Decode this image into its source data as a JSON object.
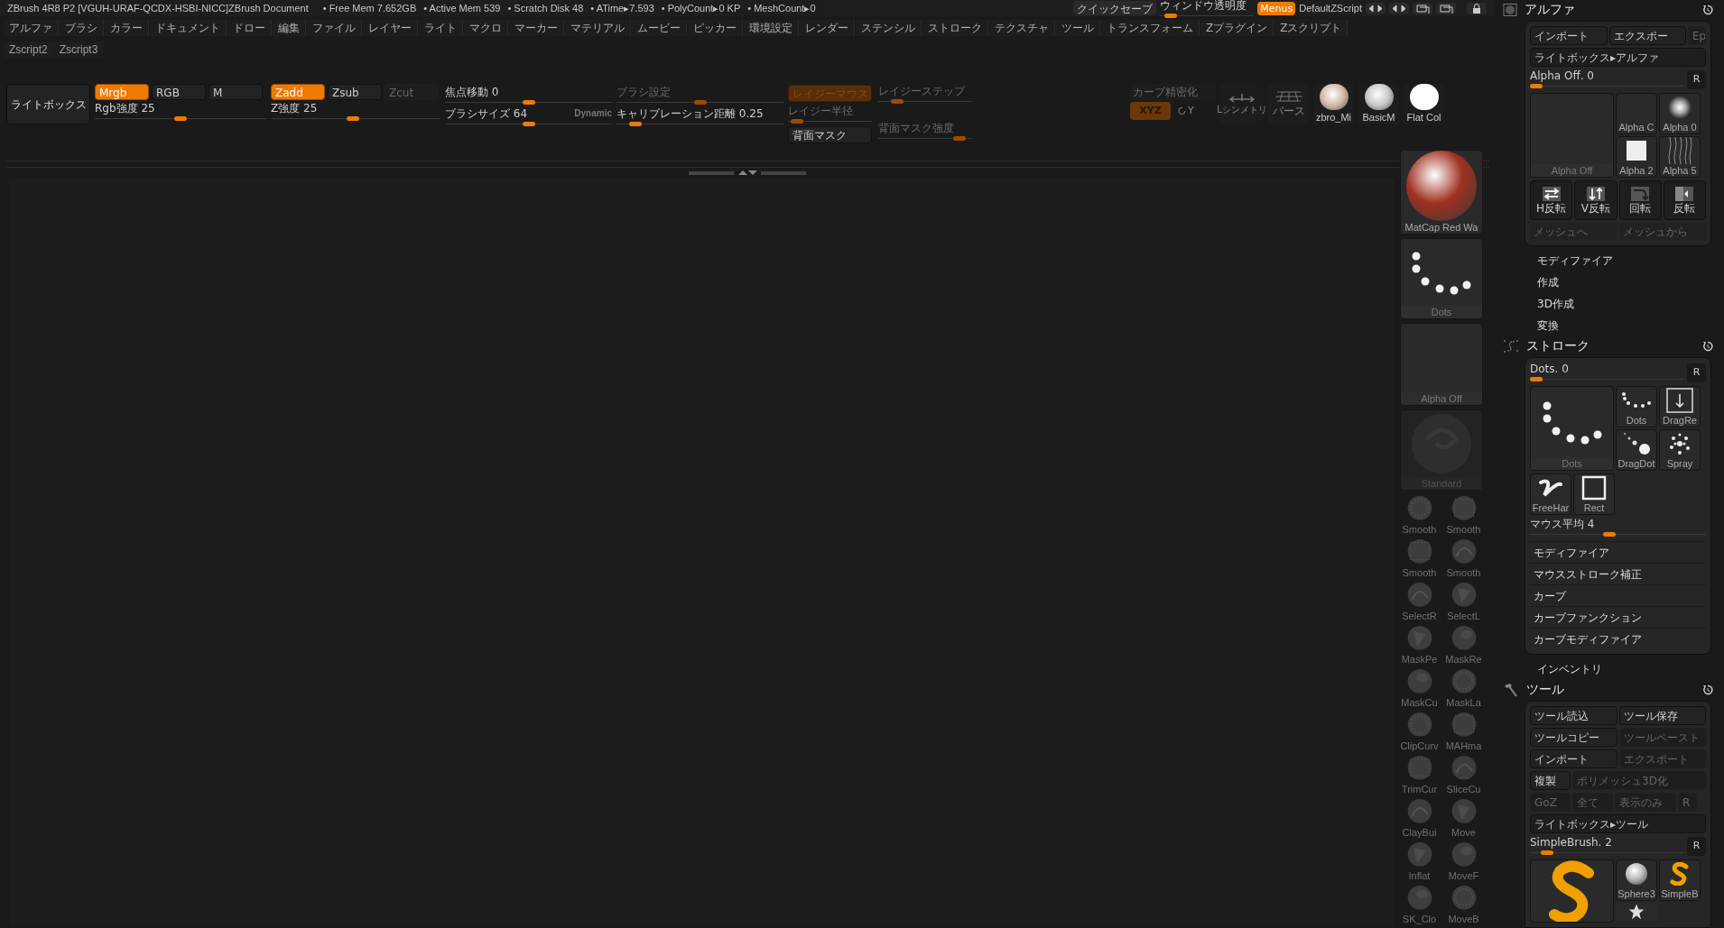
{
  "title_bar": {
    "title": "ZBrush 4R8 P2 [VGUH-URAF-QCDX-HSBI-NICC]ZBrush Document",
    "stats": [
      "• Free Mem 7.652GB",
      "• Active Mem 539",
      "• Scratch Disk 48",
      "• ATime▸7.593",
      "• PolyCount▸0 KP",
      "• MeshCount▸0"
    ],
    "quick_save": "クイックセーブ",
    "window_opacity": {
      "label": "ウィンドウ透明度",
      "level": 0.05
    },
    "menus_button": {
      "label": "Menus",
      "selected": true
    },
    "script_name": "DefaultZScript"
  },
  "menu_bar": [
    "アルファ",
    "ブラシ",
    "カラー",
    "ドキュメント",
    "ドロー",
    "編集",
    "ファイル",
    "レイヤー",
    "ライト",
    "マクロ",
    "マーカー",
    "マテリアル",
    "ムービー",
    "ピッカー",
    "環境設定",
    "レンダー",
    "ステンシル",
    "ストローク",
    "テクスチャ",
    "ツール",
    "トランスフォーム",
    "Zプラグイン",
    "Zスクリプト"
  ],
  "script_tabs": [
    "Zscript2",
    "Zscript3"
  ],
  "toolbar": {
    "lightbox": "ライトボックス",
    "rgb_modes": [
      {
        "label": "Mrgb",
        "selected": true
      },
      {
        "label": "RGB",
        "selected": false
      },
      {
        "label": "M",
        "selected": false
      }
    ],
    "rgb_intensity": {
      "label": "Rgb強度 25",
      "level": 0.5
    },
    "z_modes": [
      {
        "label": "Zadd",
        "selected": true,
        "disabled": false
      },
      {
        "label": "Zsub",
        "selected": false,
        "disabled": false
      },
      {
        "label": "Zcut",
        "selected": false,
        "disabled": true
      }
    ],
    "z_intensity": {
      "label": "Z強度 25",
      "level": 0.48
    },
    "focal_shift": {
      "label": "焦点移動 0",
      "level": 0.5
    },
    "draw_size": {
      "label": "ブラシサイズ 64",
      "level": 0.5
    },
    "dynamic": "Dynamic",
    "brush_settings": {
      "label": "ブラシ設定",
      "level": 0.5,
      "disabled": true
    },
    "calibration": {
      "label": "キャリブレーション距離 0.25",
      "level": 0.08,
      "disabled": false
    },
    "lazy_mouse": {
      "label": "レイジーマウス",
      "selected": true,
      "disabled": true
    },
    "lazy_step": {
      "label": "レイジーステップ",
      "level": 0.15,
      "disabled": true
    },
    "lazy_radius": {
      "label": "レイジー半径",
      "level": 0.04,
      "disabled": true
    },
    "backface_mask": {
      "label": "背面マスク",
      "selected": false
    },
    "backface_intensity": {
      "label": "背面マスク強度",
      "level": 0.92,
      "disabled": true
    },
    "curve_refine": "カーブ精密化",
    "xyz": {
      "label": "XYZ",
      "selected": true,
      "disabled": true
    },
    "rotate_y": "Y",
    "symmetry": "Lシンメトリ",
    "perspective": "パース",
    "materials": [
      {
        "label": "zbro_Mi",
        "color": "#d2b8a8"
      },
      {
        "label": "BasicM",
        "color": "#c8c8c8"
      },
      {
        "label": "Flat Col",
        "color": "#ffffff"
      }
    ]
  },
  "tray": {
    "material": "MatCap Red Wa",
    "stroke": "Dots",
    "alpha": "Alpha Off",
    "brush": "Standard",
    "brushes": [
      "Smooth",
      "Smooth",
      "Smooth",
      "Smooth",
      "SelectR",
      "SelectL",
      "MaskPe",
      "MaskRe",
      "MaskCu",
      "MaskLa",
      "ClipCurv",
      "MAHma",
      "TrimCur",
      "SliceCu",
      "ClayBui",
      "Move",
      "Inflat",
      "MoveF",
      "SK_Clo",
      "MoveB"
    ]
  },
  "alpha_panel": {
    "title": "アルファ",
    "buttons": [
      {
        "label": "インポート",
        "disabled": false
      },
      {
        "label": "エクスポー",
        "disabled": false
      },
      {
        "label": "Ep",
        "disabled": true
      }
    ],
    "lightbox": "ライトボックス▸アルファ",
    "slider": {
      "label": "Alpha Off. 0",
      "level": 0
    },
    "reset": "R",
    "current": "Alpha Off",
    "thumbs": [
      "Alpha C",
      "Alpha 0",
      "Alpha 2",
      "Alpha 5"
    ],
    "actions": [
      "H反転",
      "V反転",
      "回転",
      "反転"
    ],
    "mesh_buttons": [
      "メッシュへ",
      "メッシュから"
    ],
    "subpalettes": [
      "モディファイア",
      "作成",
      "3D作成",
      "変換"
    ]
  },
  "stroke_panel": {
    "title": "ストローク",
    "slider": {
      "label": "Dots. 0",
      "level": 0
    },
    "reset": "R",
    "current": "Dots",
    "thumbs": [
      "Dots",
      "DragRe",
      "DragDot",
      "Spray",
      "FreeHar",
      "Rect"
    ],
    "mouse_avg": {
      "label": "マウス平均 4",
      "level": 0.45
    },
    "subpalettes": [
      "モディファイア",
      "マウスストローク補正",
      "カーブ",
      "カーブファンクション",
      "カーブモディファイア"
    ]
  },
  "inventory": "インベントリ",
  "tool_panel": {
    "title": "ツール",
    "rows": [
      [
        {
          "label": "ツール読込",
          "disabled": false
        },
        {
          "label": "ツール保存",
          "disabled": false
        }
      ],
      [
        {
          "label": "ツールコピー",
          "disabled": false
        },
        {
          "label": "ツールペースト",
          "disabled": true
        }
      ],
      [
        {
          "label": "インポート",
          "disabled": false
        },
        {
          "label": "エクスポート",
          "disabled": true
        }
      ],
      [
        {
          "label": "複製",
          "disabled": false
        },
        {
          "label": "ポリメッシュ3D化",
          "disabled": true
        }
      ],
      [
        {
          "label": "GoZ",
          "disabled": true
        },
        {
          "label": "全て",
          "disabled": true
        },
        {
          "label": "表示のみ",
          "disabled": true
        },
        {
          "label": "R",
          "disabled": true
        }
      ]
    ],
    "lightbox": "ライトボックス▸ツール",
    "slider": {
      "label": "SimpleBrush. 2",
      "level": 0.08
    },
    "reset": "R",
    "thumbs": [
      "Sphere3",
      "SimpleB"
    ]
  }
}
